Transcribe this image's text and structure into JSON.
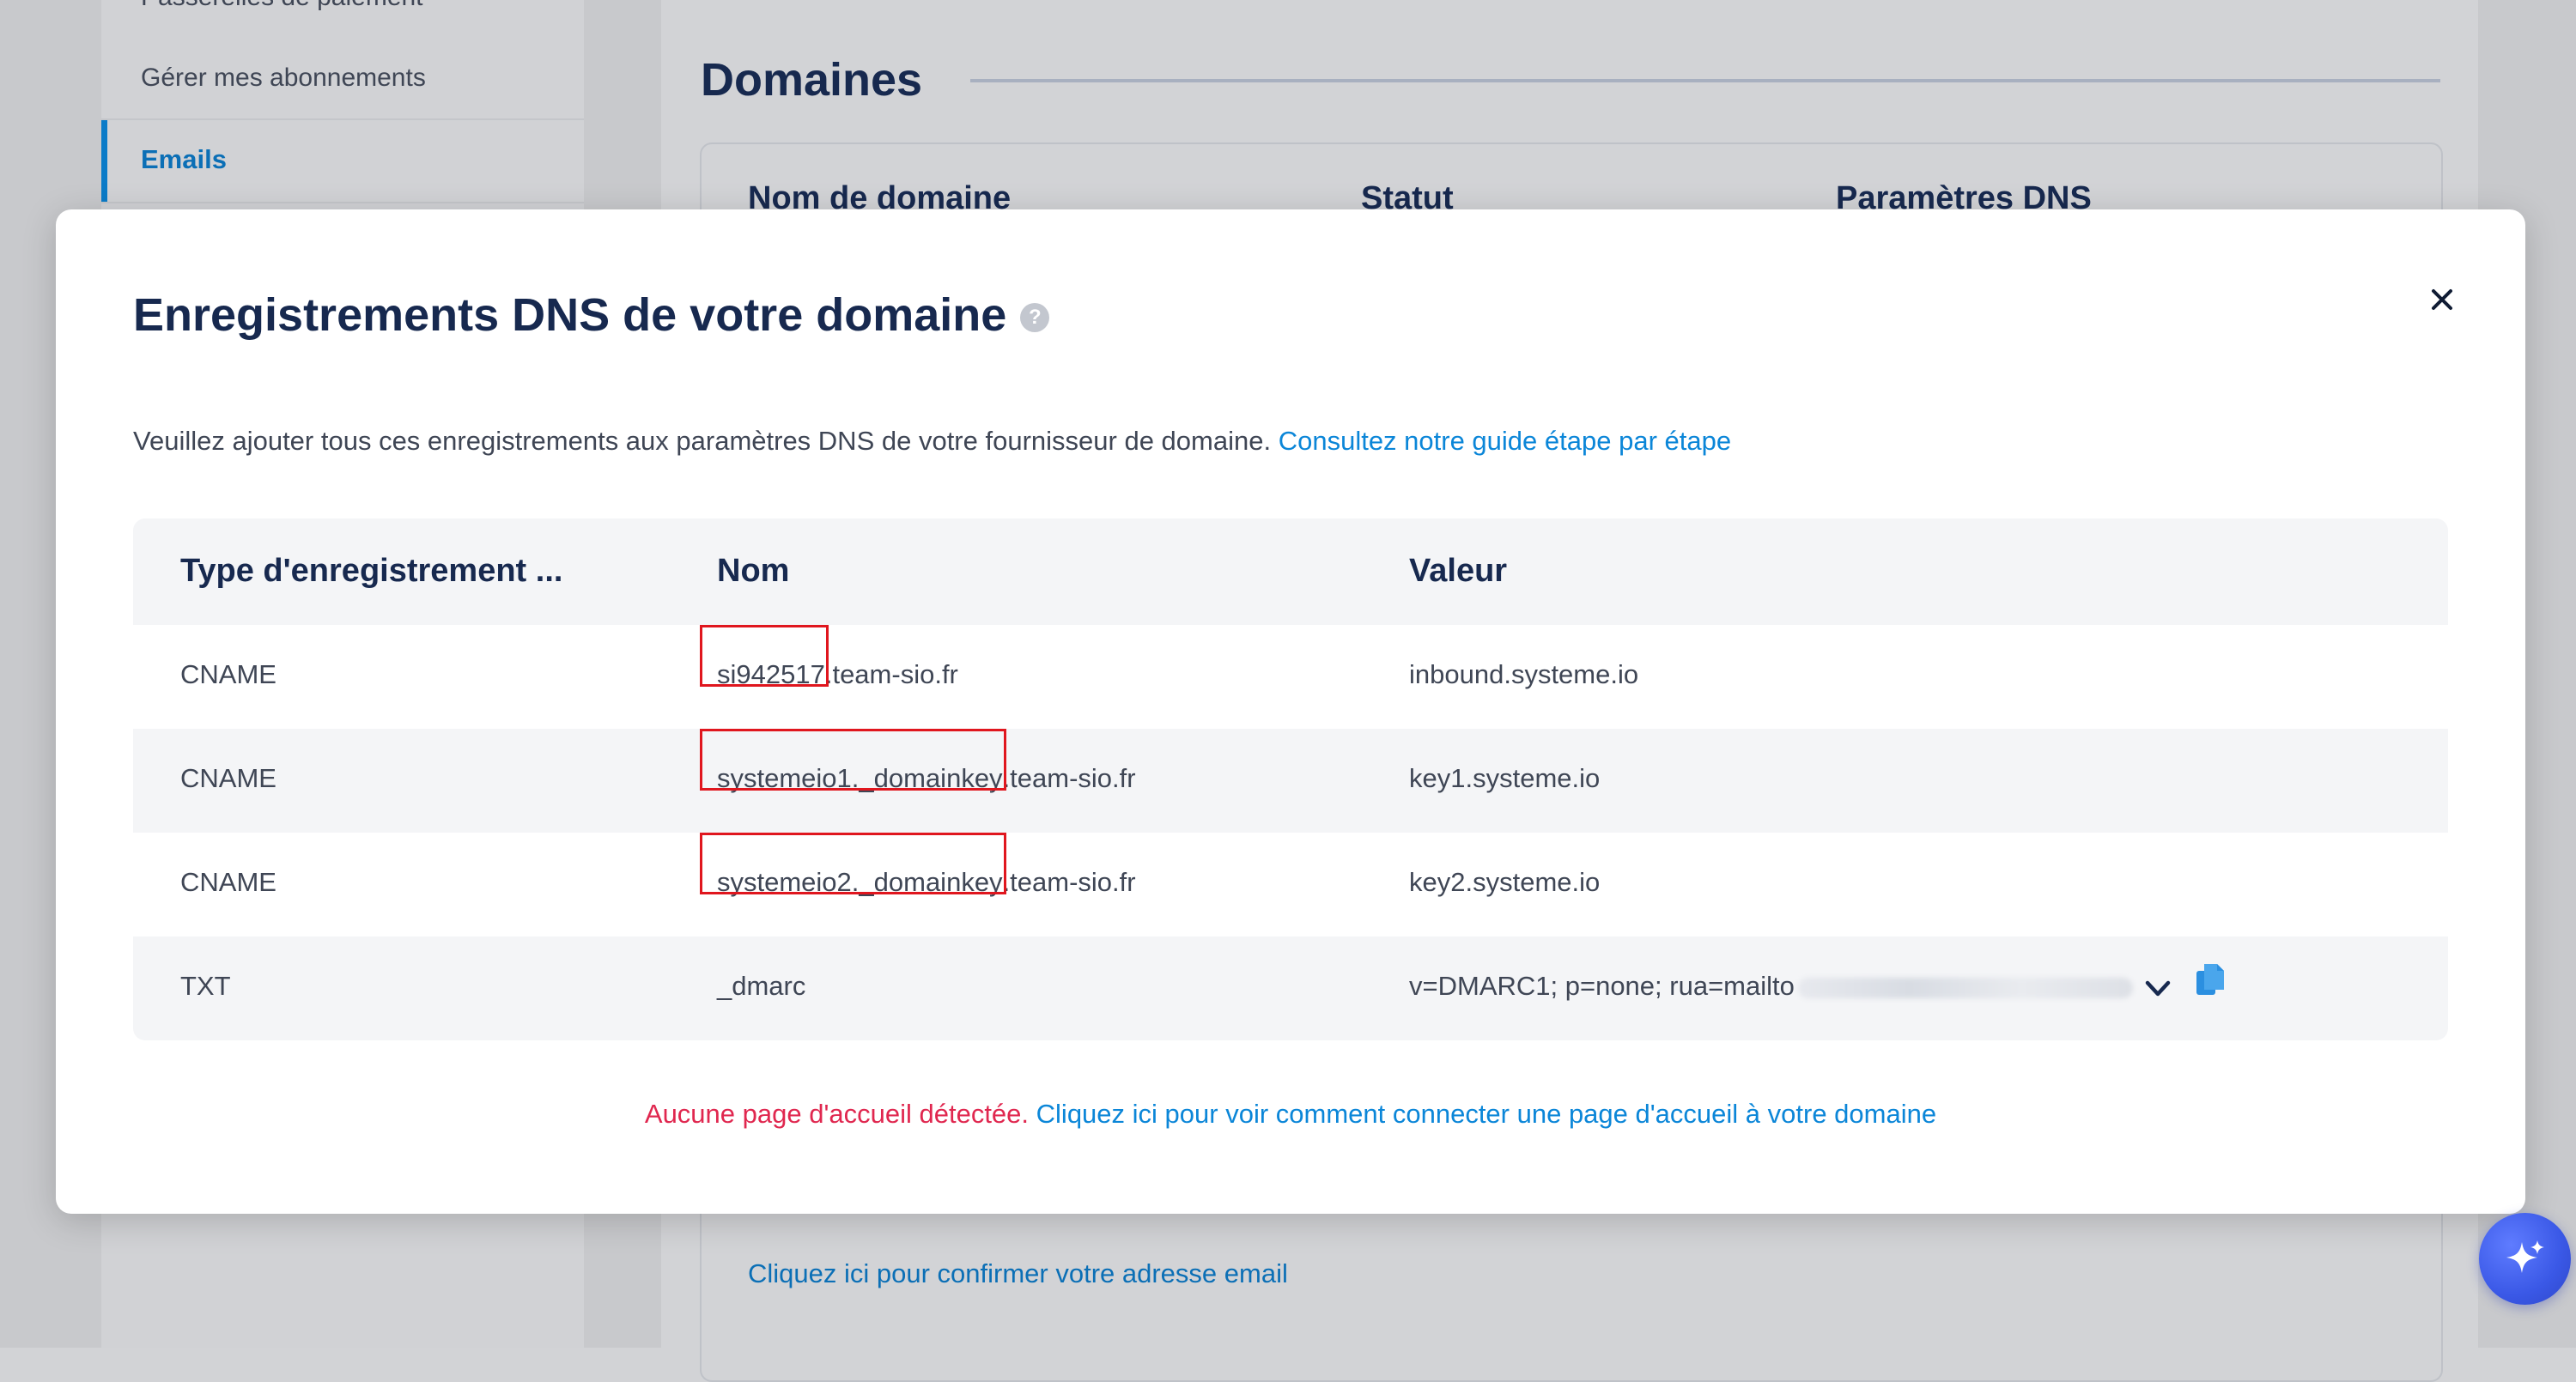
{
  "background": {
    "sidebar": {
      "partial_item": "Passerelles de paiement",
      "subscriptions": "Gérer mes abonnements",
      "active_item": "Emails"
    },
    "section_title": "Domaines",
    "table_headers": [
      "Nom de domaine",
      "Statut",
      "Paramètres DNS"
    ],
    "confirm_link": "Cliquez ici pour confirmer votre adresse email"
  },
  "modal": {
    "title": "Enregistrements DNS de votre domaine",
    "help_icon_glyph": "?",
    "close_glyph": "✕",
    "instructions": "Veuillez ajouter tous ces enregistrements aux paramètres DNS de votre fournisseur de domaine.",
    "guide_link": "Consultez notre guide étape par étape",
    "table": {
      "headers": {
        "type": "Type d'enregistrement ...",
        "name": "Nom",
        "value": "Valeur"
      },
      "rows": [
        {
          "type": "CNAME",
          "name_prefix": "si942517",
          "name_suffix": ".team-sio.fr",
          "value": "inbound.systeme.io"
        },
        {
          "type": "CNAME",
          "name_prefix": "systemeio1._domainkey",
          "name_suffix": ".team-sio.fr",
          "value": "key1.systeme.io"
        },
        {
          "type": "CNAME",
          "name_prefix": "systemeio2._domainkey",
          "name_suffix": ".team-sio.fr",
          "value": "key2.systeme.io"
        },
        {
          "type": "TXT",
          "name": "_dmarc",
          "value": "v=DMARC1; p=none; rua=mailto"
        }
      ]
    },
    "footer": {
      "warning": "Aucune page d'accueil détectée.",
      "link": "Cliquez ici pour voir comment connecter une page d'accueil à votre domaine"
    }
  },
  "icons": {
    "help": "help-circle-icon",
    "close": "close-icon",
    "expand": "chevron-down-icon",
    "copy": "copy-icon",
    "assistant": "sparkles-icon"
  },
  "colors": {
    "accent_link": "#0b86d8",
    "warning": "#e0274f",
    "highlight_box": "#e0161e",
    "title_navy": "#17294f",
    "assistant_button": "#3a58e6"
  }
}
